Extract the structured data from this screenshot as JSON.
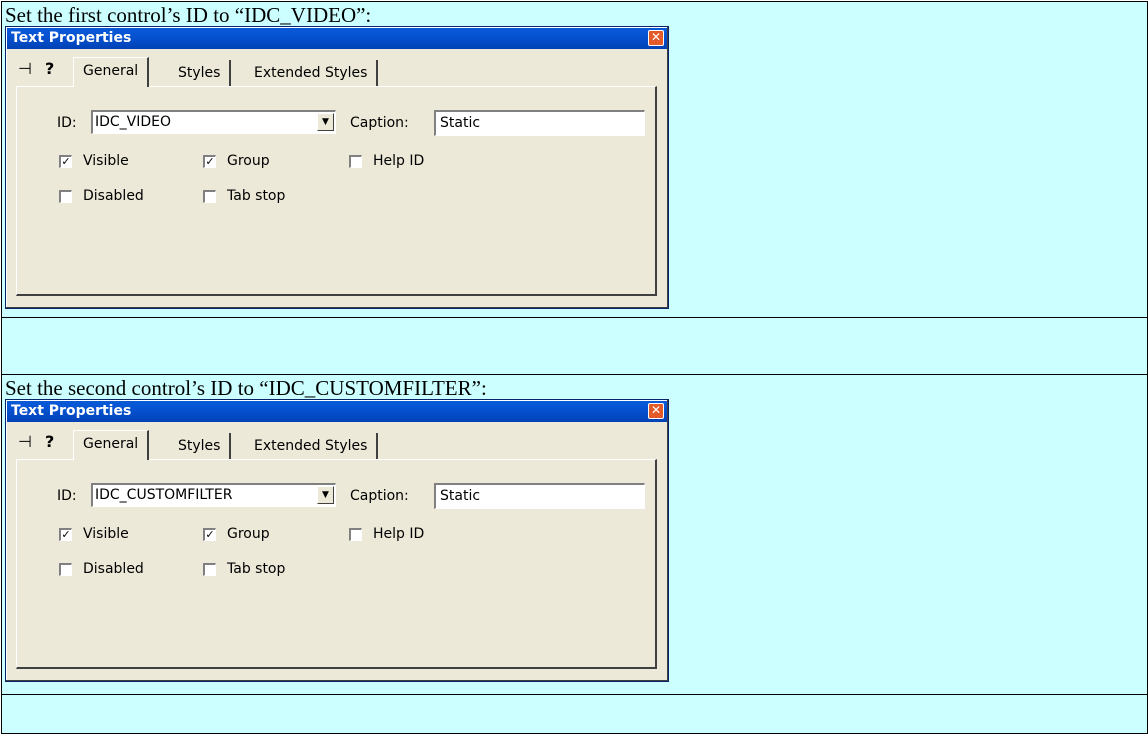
{
  "rows": [
    {
      "instruction": "Set the first control’s ID to “IDC_VIDEO”:",
      "dialog": {
        "title": "Text Properties",
        "tabs": [
          "General",
          "Styles",
          "Extended Styles"
        ],
        "id_label": "ID:",
        "id_value": "IDC_VIDEO",
        "caption_label": "Caption:",
        "caption_value": "Static",
        "checkboxes": [
          {
            "label": "Visible",
            "checked": true
          },
          {
            "label": "Group",
            "checked": true
          },
          {
            "label": "Help ID",
            "checked": false
          },
          {
            "label": "Disabled",
            "checked": false
          },
          {
            "label": "Tab stop",
            "checked": false
          }
        ]
      }
    },
    {
      "instruction": "Set the second control’s ID to “IDC_CUSTOMFILTER”:",
      "dialog": {
        "title": "Text Properties",
        "tabs": [
          "General",
          "Styles",
          "Extended Styles"
        ],
        "id_label": "ID:",
        "id_value": "IDC_CUSTOMFILTER",
        "caption_label": "Caption:",
        "caption_value": "Static",
        "checkboxes": [
          {
            "label": "Visible",
            "checked": true
          },
          {
            "label": "Group",
            "checked": true
          },
          {
            "label": "Help ID",
            "checked": false
          },
          {
            "label": "Disabled",
            "checked": false
          },
          {
            "label": "Tab stop",
            "checked": false
          }
        ]
      }
    }
  ],
  "icons": {
    "pin": "pushpin-icon",
    "help": "help-icon",
    "close": "close-icon",
    "dropdown": "chevron-down-icon"
  },
  "colors": {
    "background": "#ccffff",
    "titlebar": "#0552d1",
    "dialog": "#ece9d8",
    "close": "#e25a2a"
  }
}
